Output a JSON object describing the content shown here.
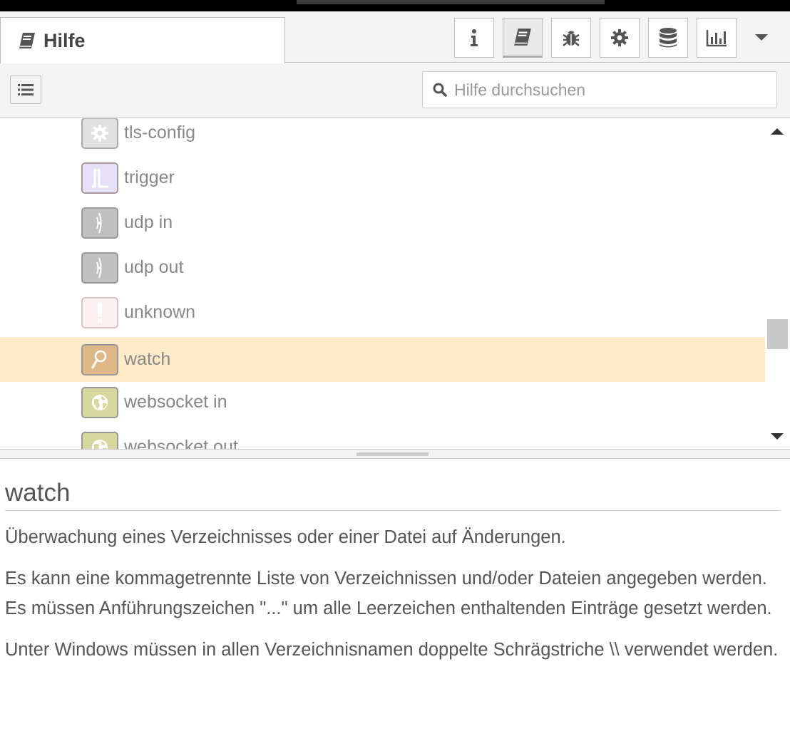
{
  "sidebar_tab": {
    "label": "Hilfe"
  },
  "toolbar_buttons": [
    "info-icon",
    "book-icon",
    "bug-icon",
    "gear-icon",
    "database-icon",
    "chart-icon",
    "chevron-down-icon"
  ],
  "search": {
    "placeholder": "Hilfe durchsuchen",
    "value": ""
  },
  "node_list": [
    {
      "label": "tls-config",
      "icon": "gear-icon",
      "color": "#e0e0e0"
    },
    {
      "label": "trigger",
      "icon": "trigger-icon",
      "color": "#e6e0f8"
    },
    {
      "label": "udp in",
      "icon": "bridge-icon",
      "color": "#c0c0c0"
    },
    {
      "label": "udp out",
      "icon": "bridge-icon",
      "color": "#c0c0c0"
    },
    {
      "label": "unknown",
      "icon": "alert-icon",
      "color": "#fdf0f0"
    },
    {
      "label": "watch",
      "icon": "watch-icon",
      "color": "#deb887",
      "selected": true
    },
    {
      "label": "websocket in",
      "icon": "globe-icon",
      "color": "#d7d7a0"
    },
    {
      "label": "websocket out",
      "icon": "globe-icon",
      "color": "#d7d7a0"
    }
  ],
  "help": {
    "title": "watch",
    "paragraphs": [
      "Überwachung eines Verzeichnisses oder einer Datei auf Änderungen.",
      "Es kann eine kommagetrennte Liste von Verzeichnissen und/oder Dateien angegeben werden. Es müssen Anführungszeichen \"...\" um alle Leerzeichen enthaltenden Einträge gesetzt werden.",
      "Unter Windows müssen in allen Verzeichnisnamen doppelte Schrägstriche \\\\ verwendet werden."
    ]
  }
}
